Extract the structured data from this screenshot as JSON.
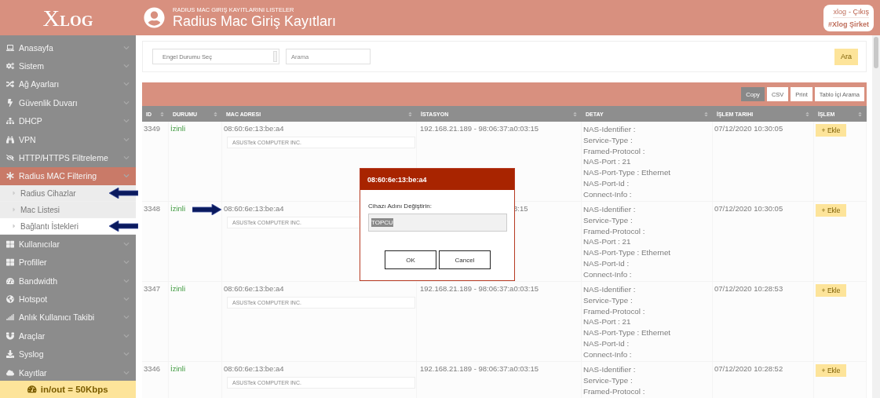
{
  "logo": {
    "initial": "X",
    "rest": "LOG"
  },
  "header": {
    "subtitle": "RADIUS MAC GIRIŞ KAYITLARINI LISTELER",
    "title": "Radius Mac Giriş Kayıtları",
    "user": "xlog",
    "logout": "- Çıkış",
    "company": "#Xlog Şirket"
  },
  "sidebar": {
    "items": [
      {
        "label": "Anasayfa",
        "expanded": false
      },
      {
        "label": "Sistem",
        "expanded": false
      },
      {
        "label": "Ağ Ayarları",
        "expanded": false
      },
      {
        "label": "Güvenlik Duvarı",
        "expanded": false
      },
      {
        "label": "DHCP",
        "expanded": false
      },
      {
        "label": "VPN",
        "expanded": false
      },
      {
        "label": "HTTP/HTTPS Filtreleme",
        "expanded": false
      },
      {
        "label": "Radius MAC Filtering",
        "expanded": true,
        "children": [
          {
            "label": "Radius Cihazlar",
            "arrow": true,
            "selected": false
          },
          {
            "label": "Mac Listesi",
            "arrow": false,
            "selected": false
          },
          {
            "label": "Bağlantı İstekleri",
            "arrow": true,
            "selected": true
          }
        ]
      },
      {
        "label": "Kullanıcılar",
        "expanded": false
      },
      {
        "label": "Profiller",
        "expanded": false
      },
      {
        "label": "Bandwidth",
        "expanded": false
      },
      {
        "label": "Hotspot",
        "expanded": false
      },
      {
        "label": "Anlık Kullanıcı Takibi",
        "expanded": false
      },
      {
        "label": "Araçlar",
        "expanded": false
      },
      {
        "label": "Syslog",
        "expanded": false
      },
      {
        "label": "Kayıtlar",
        "expanded": false
      }
    ],
    "footer": "in/out = 50Kbps"
  },
  "filter": {
    "select": "Engel Durumu Seç",
    "search_placeholder": "Arama",
    "button": "Ara"
  },
  "table": {
    "tools": [
      {
        "label": "Copy",
        "selected": true
      },
      {
        "label": "CSV",
        "selected": false
      },
      {
        "label": "Print",
        "selected": false
      },
      {
        "label": "Tablo İçi Arama",
        "selected": false
      }
    ],
    "columns": [
      "ID",
      "DURUMU",
      "MAC ADRESI",
      "İSTASYON",
      "DETAY",
      "İŞLEM TARIHI",
      "İŞLEM"
    ],
    "rows": [
      {
        "id": "3349",
        "status": "İzinli",
        "mac": "08:60:6e:13:be:a4",
        "vendor": "ASUSTek COMPUTER INC.",
        "station": "192.168.21.189 - 98:06:37:a0:03:15",
        "station_covered": false,
        "arrow": false,
        "detail": [
          "NAS-Identifier :",
          "Service-Type :",
          "Framed-Protocol :",
          "NAS-Port : 21",
          "NAS-Port-Type : Ethernet",
          "NAS-Port-Id :",
          "Connect-Info :"
        ],
        "date": "07/12/2020 10:30:05",
        "action": "+ Ekle"
      },
      {
        "id": "3348",
        "status": "İzinli",
        "mac": "08:60:6e:13:be:a4",
        "vendor": "ASUSTek COMPUTER INC.",
        "station": "3:15",
        "station_covered": true,
        "arrow": true,
        "detail": [
          "NAS-Identifier :",
          "Service-Type :",
          "Framed-Protocol :",
          "NAS-Port : 21",
          "NAS-Port-Type : Ethernet",
          "NAS-Port-Id :",
          "Connect-Info :"
        ],
        "date": "07/12/2020 10:30:05",
        "action": "+ Ekle"
      },
      {
        "id": "3347",
        "status": "İzinli",
        "mac": "08:60:6e:13:be:a4",
        "vendor": "ASUSTek COMPUTER INC.",
        "station": "192.168.21.189 - 98:06:37:a0:03:15",
        "station_covered": false,
        "arrow": false,
        "detail": [
          "NAS-Identifier :",
          "Service-Type :",
          "Framed-Protocol :",
          "NAS-Port : 21",
          "NAS-Port-Type : Ethernet",
          "NAS-Port-Id :",
          "Connect-Info :"
        ],
        "date": "07/12/2020 10:28:53",
        "action": "+ Ekle"
      },
      {
        "id": "3346",
        "status": "İzinli",
        "mac": "08:60:6e:13:be:a4",
        "vendor": "ASUSTek COMPUTER INC.",
        "station": "192.168.21.189 - 98:06:37:a0:03:15",
        "station_covered": false,
        "arrow": false,
        "detail": [
          "NAS-Identifier :",
          "Service-Type :",
          "Framed-Protocol :"
        ],
        "date": "07/12/2020 10:28:52",
        "action": "+ Ekle"
      }
    ]
  },
  "dialog": {
    "title": "08:60:6e:13:be:a4",
    "label": "Cihazı Adını Değiştirin:",
    "value": "TOPCU",
    "value_selected": true,
    "buttons": [
      "OK",
      "Cancel"
    ]
  }
}
